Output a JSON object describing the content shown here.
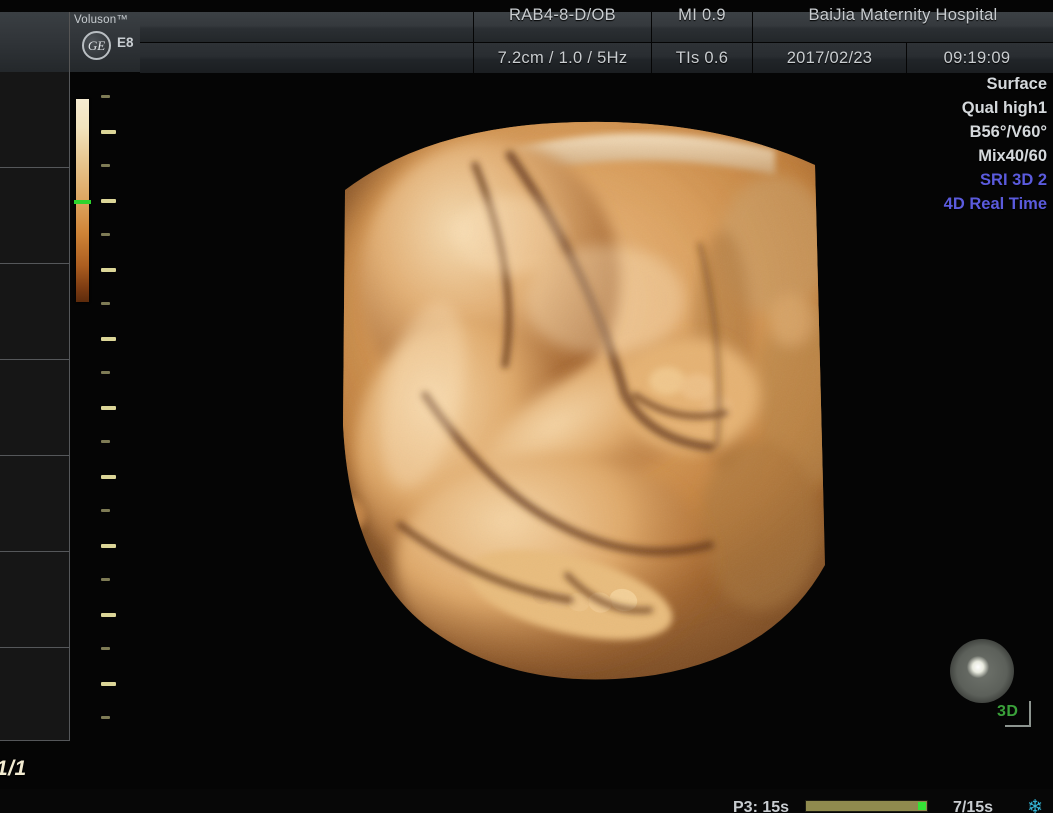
{
  "device": {
    "brand": "Voluson™",
    "model": "E8",
    "ge_monogram": "GE"
  },
  "header": {
    "probe": "RAB4-8-D/OB",
    "mi": "MI 0.9",
    "depth_settings": "7.2cm / 1.0 / 5Hz",
    "tis": "TIs 0.6",
    "hospital": "BaiJia Maternity Hospital",
    "date": "2017/02/23",
    "time": "09:19:09"
  },
  "params": {
    "render_mode": "Surface",
    "quality": "Qual high1",
    "angles": "B56°/V60°",
    "mix": "Mix40/60",
    "sri": "SRI 3D 2",
    "mode": "4D Real Time",
    "accent_color": "#5b5bdd"
  },
  "viewport": {
    "orientation_label": "3D",
    "orientation_color": "#3aa13a",
    "light_indicator": "light-source-sphere"
  },
  "sidebar": {
    "page_indicator": "1/1",
    "cells": 7
  },
  "colorbar": {
    "name": "sepia-gain-map",
    "marker_color": "#2dd42d",
    "top_color": "#f6ecd2",
    "mid_color": "#dda560",
    "bottom_color": "#5d2b0c"
  },
  "statusbar": {
    "cine_left": "P3: 15s",
    "cine_right": "7/15s",
    "snowflake_icon": "freeze-icon"
  }
}
